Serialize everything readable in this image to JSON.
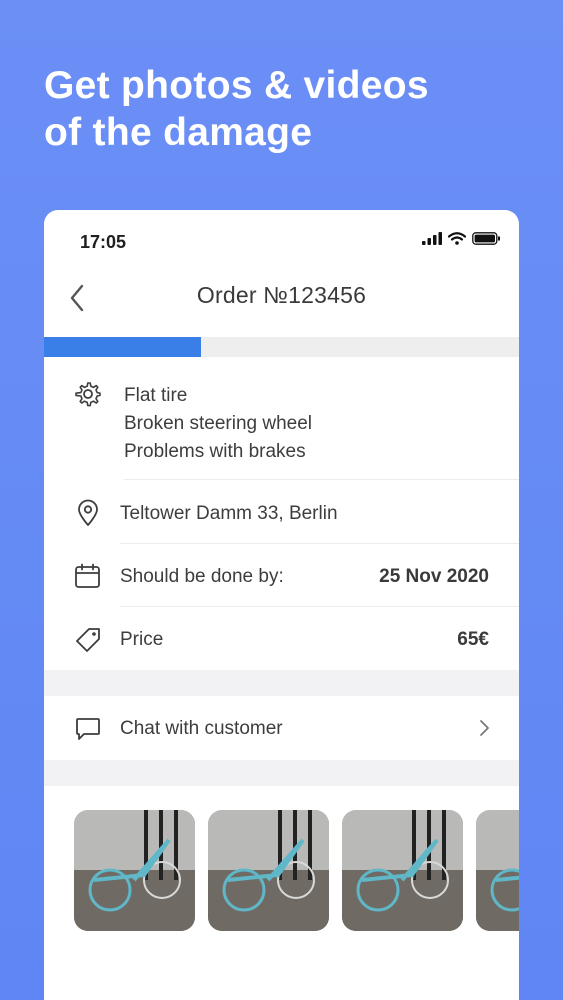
{
  "headline": {
    "line1": "Get photos & videos",
    "line2": "of the damage"
  },
  "status_bar": {
    "time": "17:05",
    "icons": [
      "signal-icon",
      "wifi-icon",
      "battery-icon"
    ]
  },
  "nav": {
    "title": "Order №123456",
    "back_icon": "chevron-left-icon"
  },
  "progress": {
    "fraction": 0.33,
    "color": "#3a7ee8"
  },
  "issues": {
    "icon": "gear-icon",
    "items": [
      "Flat tire",
      "Broken steering wheel",
      "Problems with brakes"
    ]
  },
  "address": {
    "icon": "location-pin-icon",
    "text": "Teltower Damm 33, Berlin"
  },
  "deadline": {
    "icon": "calendar-icon",
    "label": "Should be done by:",
    "value": "25 Nov 2020"
  },
  "price": {
    "icon": "price-tag-icon",
    "label": "Price",
    "value": "65€"
  },
  "chat": {
    "icon": "chat-bubble-icon",
    "label": "Chat with customer",
    "arrow_icon": "chevron-right-icon"
  },
  "photos": {
    "count_visible": 4,
    "subject": "bicycle-photo"
  },
  "colors": {
    "background": "#6b8ff5",
    "accent": "#3a7ee8"
  }
}
